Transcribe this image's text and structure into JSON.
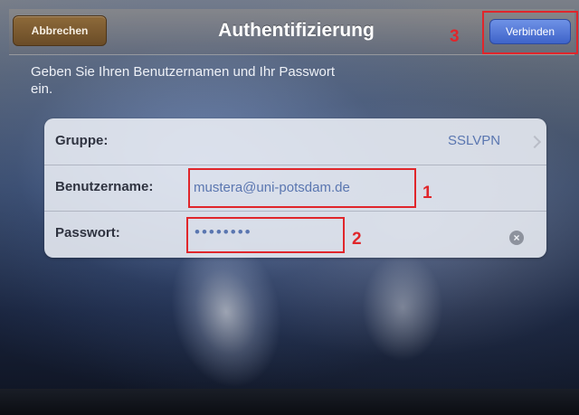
{
  "navbar": {
    "cancel_label": "Abbrechen",
    "title": "Authentifizierung",
    "connect_label": "Verbinden"
  },
  "instructions": "Geben Sie Ihren Benutzernamen und Ihr Passwort ein.",
  "form": {
    "group_label": "Gruppe:",
    "group_value": "SSLVPN",
    "username_label": "Benutzername:",
    "username_value": "mustera@uni-potsdam.de",
    "password_label": "Passwort:",
    "password_value": "••••••••"
  },
  "annotations": {
    "marker_1": "1",
    "marker_2": "2",
    "marker_3": "3"
  },
  "icons": {
    "group_disclosure": "chevron-right-icon",
    "password_clear": "clear-icon"
  },
  "colors": {
    "annotation_red": "#e0262b",
    "connect_blue": "#3e63c9",
    "cancel_brown": "#6a4c27",
    "value_blue": "#5a76b0"
  }
}
